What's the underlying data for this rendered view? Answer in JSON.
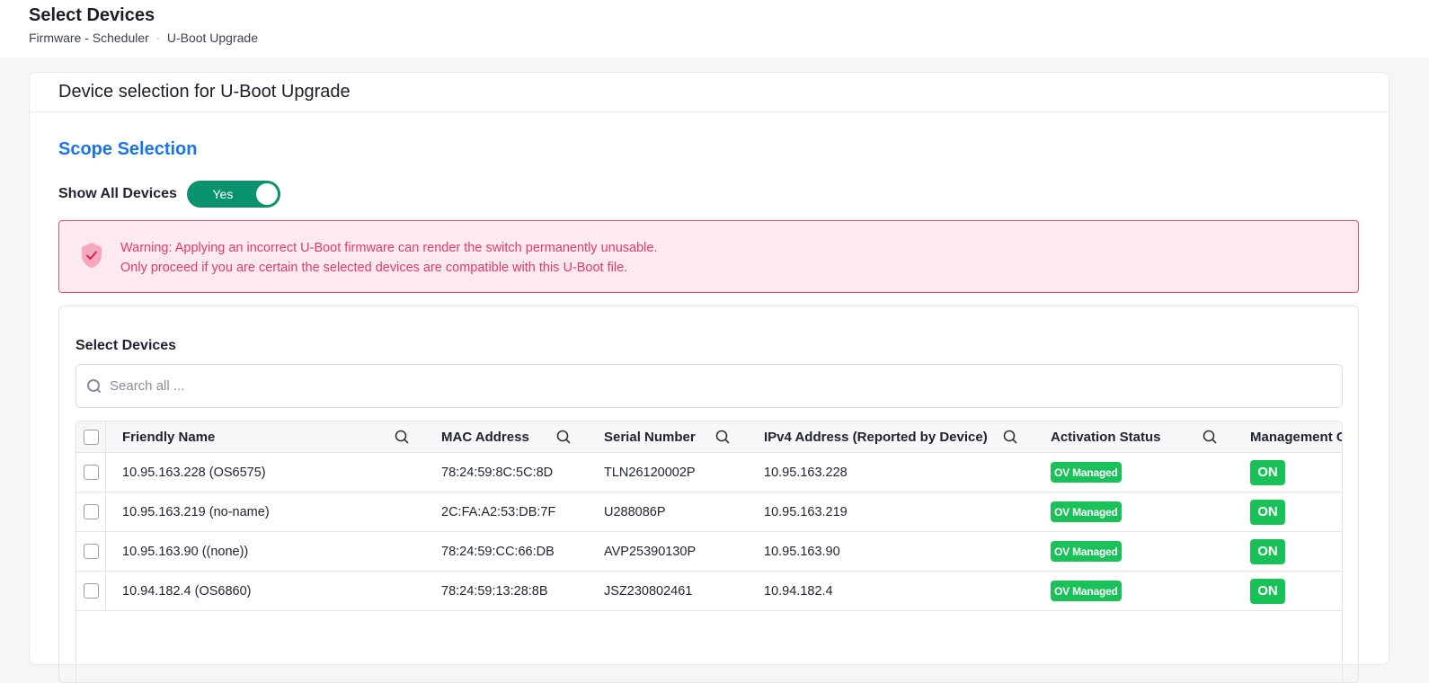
{
  "header": {
    "title": "Select Devices",
    "breadcrumb": [
      "Firmware - Scheduler",
      "U-Boot Upgrade"
    ],
    "breadcrumb_separator": "-"
  },
  "card": {
    "title": "Device selection for U-Boot Upgrade"
  },
  "scope": {
    "title": "Scope Selection",
    "show_all_label": "Show All Devices",
    "show_all_value": "Yes"
  },
  "warning": {
    "line1": "Warning: Applying an incorrect U-Boot firmware can render the switch permanently unusable.",
    "line2": "Only proceed if you are certain the selected devices are compatible with this U-Boot file.",
    "icon": "shield-check-icon",
    "color": "#e33a68"
  },
  "table": {
    "title": "Select Devices",
    "search_placeholder": "Search all ...",
    "columns": [
      "Friendly Name",
      "MAC Address",
      "Serial Number",
      "IPv4 Address (Reported by Device)",
      "Activation Status",
      "Management C"
    ],
    "rows": [
      [
        "10.95.163.228 (OS6575)",
        "78:24:59:8C:5C:8D",
        "TLN26120002P",
        "10.95.163.228",
        "OV Managed",
        "ON"
      ],
      [
        "10.95.163.219 (no-name)",
        "2C:FA:A2:53:DB:7F",
        "U288086P",
        "10.95.163.219",
        "OV Managed",
        "ON"
      ],
      [
        "10.95.163.90 ((none))",
        "78:24:59:CC:66:DB",
        "AVP25390130P",
        "10.95.163.90",
        "OV Managed",
        "ON"
      ],
      [
        "10.94.182.4 (OS6860)",
        "78:24:59:13:28:8B",
        "JSZ230802461",
        "10.94.182.4",
        "OV Managed",
        "ON"
      ]
    ]
  },
  "colors": {
    "accent_blue": "#1a73e8",
    "toggle_green": "#08936d",
    "badge_green": "#19c158",
    "warning_bg": "#fdeaf0",
    "warning_border": "#ea4d76"
  }
}
